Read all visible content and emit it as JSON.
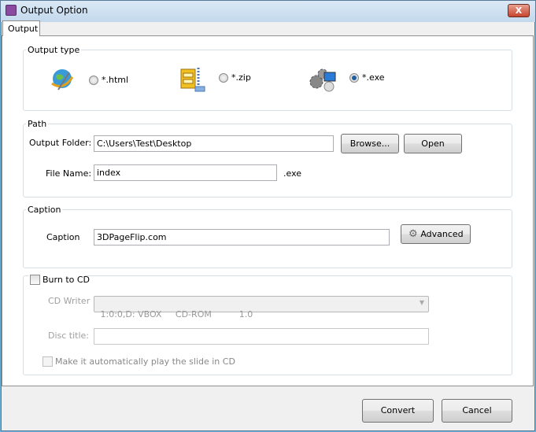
{
  "window": {
    "title": "Output Option",
    "close_label": "X"
  },
  "tabs": [
    {
      "label": "Output"
    }
  ],
  "output_type": {
    "legend": "Output type",
    "options": [
      {
        "label": "*.html",
        "icon": "globe-pen-icon",
        "selected": false
      },
      {
        "label": "*.zip",
        "icon": "zip-archive-icon",
        "selected": false
      },
      {
        "label": "*.exe",
        "icon": "gears-computer-icon",
        "selected": true
      }
    ]
  },
  "path": {
    "legend": "Path",
    "output_folder_label": "Output Folder:",
    "output_folder_value": "C:\\Users\\Test\\Desktop",
    "browse_label": "Browse...",
    "open_label": "Open",
    "file_name_label": "File Name:",
    "file_name_value": "index",
    "extension": ".exe"
  },
  "caption": {
    "legend": "Caption",
    "label": "Caption",
    "value": "3DPageFlip.com",
    "advanced_label": "Advanced"
  },
  "burn": {
    "label": "Burn to CD",
    "checked": false,
    "cd_writer_label": "CD Writer",
    "cd_writer_value": "1:0:0,D: VBOX     CD-ROM          1.0",
    "disc_title_label": "Disc title:",
    "disc_title_value": "",
    "autoplay_label": "Make it automatically play the  slide in CD",
    "autoplay_checked": false
  },
  "footer": {
    "convert_label": "Convert",
    "cancel_label": "Cancel"
  }
}
